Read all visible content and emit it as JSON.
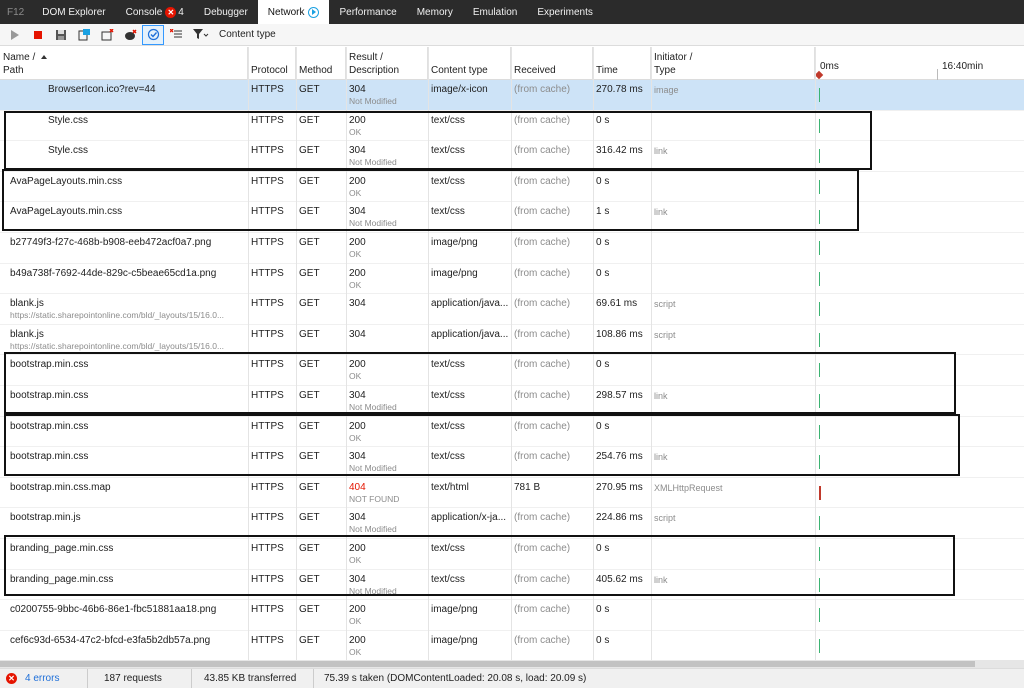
{
  "tabs": [
    {
      "label": "F12"
    },
    {
      "label": "DOM Explorer"
    },
    {
      "label": "Console",
      "badge": "4"
    },
    {
      "label": "Debugger"
    },
    {
      "label": "Network"
    },
    {
      "label": "Performance"
    },
    {
      "label": "Memory"
    },
    {
      "label": "Emulation"
    },
    {
      "label": "Experiments"
    }
  ],
  "toolbar": {
    "content_type_label": "Content type",
    "icons": [
      "play-icon",
      "stop-icon",
      "save-icon",
      "clear-entries-icon",
      "clear-cache-icon",
      "clear-cookies-icon",
      "always-refresh-icon",
      "export-icon",
      "filter-icon"
    ]
  },
  "columns": {
    "name": "Name /",
    "path": "Path",
    "protocol": "Protocol",
    "method": "Method",
    "result": "Result /",
    "description": "Description",
    "content_type": "Content type",
    "received": "Received",
    "time": "Time",
    "initiator": "Initiator /",
    "type": "Type",
    "timeline_start": "0ms",
    "timeline_end": "16:40min"
  },
  "requests": [
    {
      "name": "BrowserIcon.ico?rev=44",
      "path": "",
      "protocol": "HTTPS",
      "method": "GET",
      "result": "304",
      "description": "Not Modified",
      "content_type": "image/x-icon",
      "received": "(from cache)",
      "time": "270.78 ms",
      "initiator": "image"
    },
    {
      "name": "Style.css",
      "path": "",
      "protocol": "HTTPS",
      "method": "GET",
      "result": "200",
      "description": "OK",
      "content_type": "text/css",
      "received": "(from cache)",
      "time": "0 s",
      "initiator": ""
    },
    {
      "name": "Style.css",
      "path": "",
      "protocol": "HTTPS",
      "method": "GET",
      "result": "304",
      "description": "Not Modified",
      "content_type": "text/css",
      "received": "(from cache)",
      "time": "316.42 ms",
      "initiator": "link"
    },
    {
      "name": "AvaPageLayouts.min.css",
      "path": "",
      "protocol": "HTTPS",
      "method": "GET",
      "result": "200",
      "description": "OK",
      "content_type": "text/css",
      "received": "(from cache)",
      "time": "0 s",
      "initiator": ""
    },
    {
      "name": "AvaPageLayouts.min.css",
      "path": "",
      "protocol": "HTTPS",
      "method": "GET",
      "result": "304",
      "description": "Not Modified",
      "content_type": "text/css",
      "received": "(from cache)",
      "time": "1 s",
      "initiator": "link"
    },
    {
      "name": "b27749f3-f27c-468b-b908-eeb472acf0a7.png",
      "path": "",
      "protocol": "HTTPS",
      "method": "GET",
      "result": "200",
      "description": "OK",
      "content_type": "image/png",
      "received": "(from cache)",
      "time": "0 s",
      "initiator": ""
    },
    {
      "name": "b49a738f-7692-44de-829c-c5beae65cd1a.png",
      "path": "",
      "protocol": "HTTPS",
      "method": "GET",
      "result": "200",
      "description": "OK",
      "content_type": "image/png",
      "received": "(from cache)",
      "time": "0 s",
      "initiator": ""
    },
    {
      "name": "blank.js",
      "path": "https://static.sharepointonline.com/bld/_layouts/15/16.0...",
      "protocol": "HTTPS",
      "method": "GET",
      "result": "304",
      "description": "",
      "content_type": "application/java...",
      "received": "(from cache)",
      "time": "69.61 ms",
      "initiator": "script"
    },
    {
      "name": "blank.js",
      "path": "https://static.sharepointonline.com/bld/_layouts/15/16.0...",
      "protocol": "HTTPS",
      "method": "GET",
      "result": "304",
      "description": "",
      "content_type": "application/java...",
      "received": "(from cache)",
      "time": "108.86 ms",
      "initiator": "script"
    },
    {
      "name": "bootstrap.min.css",
      "path": "",
      "protocol": "HTTPS",
      "method": "GET",
      "result": "200",
      "description": "OK",
      "content_type": "text/css",
      "received": "(from cache)",
      "time": "0 s",
      "initiator": ""
    },
    {
      "name": "bootstrap.min.css",
      "path": "",
      "protocol": "HTTPS",
      "method": "GET",
      "result": "304",
      "description": "Not Modified",
      "content_type": "text/css",
      "received": "(from cache)",
      "time": "298.57 ms",
      "initiator": "link"
    },
    {
      "name": "bootstrap.min.css",
      "path": "",
      "protocol": "HTTPS",
      "method": "GET",
      "result": "200",
      "description": "OK",
      "content_type": "text/css",
      "received": "(from cache)",
      "time": "0 s",
      "initiator": ""
    },
    {
      "name": "bootstrap.min.css",
      "path": "",
      "protocol": "HTTPS",
      "method": "GET",
      "result": "304",
      "description": "Not Modified",
      "content_type": "text/css",
      "received": "(from cache)",
      "time": "254.76 ms",
      "initiator": "link"
    },
    {
      "name": "bootstrap.min.css.map",
      "path": "",
      "protocol": "HTTPS",
      "method": "GET",
      "result": "404",
      "description": "NOT FOUND",
      "content_type": "text/html",
      "received": "781 B",
      "time": "270.95 ms",
      "initiator": "XMLHttpRequest",
      "error": true
    },
    {
      "name": "bootstrap.min.js",
      "path": "",
      "protocol": "HTTPS",
      "method": "GET",
      "result": "304",
      "description": "Not Modified",
      "content_type": "application/x-ja...",
      "received": "(from cache)",
      "time": "224.86 ms",
      "initiator": "script"
    },
    {
      "name": "branding_page.min.css",
      "path": "",
      "protocol": "HTTPS",
      "method": "GET",
      "result": "200",
      "description": "OK",
      "content_type": "text/css",
      "received": "(from cache)",
      "time": "0 s",
      "initiator": ""
    },
    {
      "name": "branding_page.min.css",
      "path": "",
      "protocol": "HTTPS",
      "method": "GET",
      "result": "304",
      "description": "Not Modified",
      "content_type": "text/css",
      "received": "(from cache)",
      "time": "405.62 ms",
      "initiator": "link"
    },
    {
      "name": "c0200755-9bbc-46b6-86e1-fbc51881aa18.png",
      "path": "",
      "protocol": "HTTPS",
      "method": "GET",
      "result": "200",
      "description": "OK",
      "content_type": "image/png",
      "received": "(from cache)",
      "time": "0 s",
      "initiator": ""
    },
    {
      "name": "cef6c93d-6534-47c2-bfcd-e3fa5b2db57a.png",
      "path": "",
      "protocol": "HTTPS",
      "method": "GET",
      "result": "200",
      "description": "OK",
      "content_type": "image/png",
      "received": "(from cache)",
      "time": "0 s",
      "initiator": ""
    }
  ],
  "status": {
    "errors": "4 errors",
    "requests": "187 requests",
    "transferred": "43.85 KB transferred",
    "taken": "75.39 s taken (DOMContentLoaded: 20.08 s, load: 20.09 s)"
  },
  "colors": {
    "accent": "#1ba1e2",
    "error": "#e51400",
    "selected_row": "#cde3f7",
    "tab_bar": "#2b2b2b"
  }
}
